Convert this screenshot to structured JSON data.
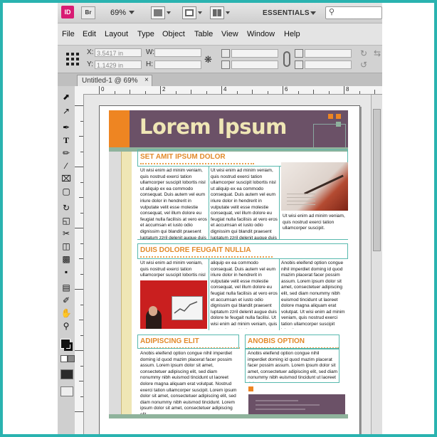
{
  "app": {
    "logo": "ID",
    "bridge": "Br",
    "zoom": "69%",
    "workspace": "ESSENTIALS",
    "colors": {
      "logo": "#d81b73",
      "accent_orange": "#ee8522",
      "header_purple": "#6b5167",
      "cream": "#efe6b5",
      "green": "#8fb39c"
    }
  },
  "menu": [
    "File",
    "Edit",
    "Layout",
    "Type",
    "Object",
    "Table",
    "View",
    "Window",
    "Help"
  ],
  "control": {
    "x_label": "X:",
    "x_value": "3.5417 in",
    "y_label": "Y:",
    "y_value": "1.1429 in",
    "w_label": "W:",
    "h_label": "H:"
  },
  "tab": {
    "title": "Untitled-1 @ 69%",
    "close": "×"
  },
  "ruler": {
    "top": [
      "0",
      "2",
      "4",
      "6",
      "8"
    ]
  },
  "doc": {
    "title": "Lorem Ipsum",
    "s1_head": "SET AMIT IPSUM  DOLOR",
    "s2_head": "DUIS DOLORE FEUGAIT NULLIA",
    "s3_head": "ADIPISCING ELIT",
    "s4_head": "ANOBIS OPTION",
    "col1": "Ut wisi enim ad minim veniam, quis nostrud exerci tation ullamcorper suscipit lobortis nisl ut aliquip ex ea commodo consequat. Duis autem vel eum iriure dolor in hendrerit in vulputate velit esse molestie consequat, vel illum dolore eu feugiat nulla facilisis at vero eros et accumsan et iusto odio dignissim qui blandit praesent luptatum zzril delenit augue duis dolore te feugait nulla",
    "col2": "Ut wisi enim ad minim veniam, quis nostrud exerci tation ullamcorper suscipit lobortis nisl ut aliquip ex ea commodo consequat. Duis autem vel eum iriure dolor in hendrerit in vulputate velit esse molestie consequat, vel illum dolore eu feugiat nulla facilisis at vero eros et accumsan et iusto odio dignissim qui blandit praesent luptatum zzril delenit augue duis dolore te. Laoreet dolore magna aliquam erat volutpat.",
    "cap1": "Ut wisi enim ad minim veniam, quis nostrud exerci tation ullamcorper suscipit.",
    "m1": "Ut wisi enim ad minim veniam, quis nostrud exerci tation ullamcorper suscipit lobortis nisl ut",
    "m2": "aliquip ex ea commodo consequat. Duis autem vel eum iriure dolor in hendrerit in vulputate velit esse molestie consequat, vel illum dolore eu feugiat nulla facilisis at vero eros et accumsan et iusto odio dignissim qui blandit praesent luptatum zzril delenit augue duis dolore te feugait nulla facilisi. Ut wisi enim ad minim veniam, quis nostrud exerci tation ullamcorper suscipit lobortis nisl.",
    "m3": "Anobis eleifend option congue nihil imperdiet doming id quod mazim placerat facer possim assum. Lorem ipsum dolor sit amet, consectetuer adipiscing elit, sed diam nonummy nibh euismod tincidunt ut laoreet dolore magna aliquam erat volutpat. Ut wisi enim ad minim veniam, quis nostrud exerci tation ullamcorper suscipit lobortis.",
    "b1": "Anobis eleifend option congue nihil imperdiet doming id quod mazim placerat facer possim assum. Lorem ipsum dolor sit amet, consectetuer adipiscing elit, sed diam nonummy nibh euismod tincidunt ut laoreet dolore magna aliquam erat volutpat. Nostrud exerci tation ullamcorper suscipit. Lorem ipsum dolor sit amet, consectetuer adipiscing elit, sed diam nonummy nibh euismod tincidunt. Lorem ipsum dolor sit amet, consectetuer adipiscing elit.",
    "b2": "Anobis eleifend option congue nihil imperdiet doming id quod mazim placerat facer possim assum. Lorem ipsum dolor sit amet, consectetuer adipiscing elit, sed diam nonummy nibh euismod tincidunt ut laoreet dolore."
  }
}
